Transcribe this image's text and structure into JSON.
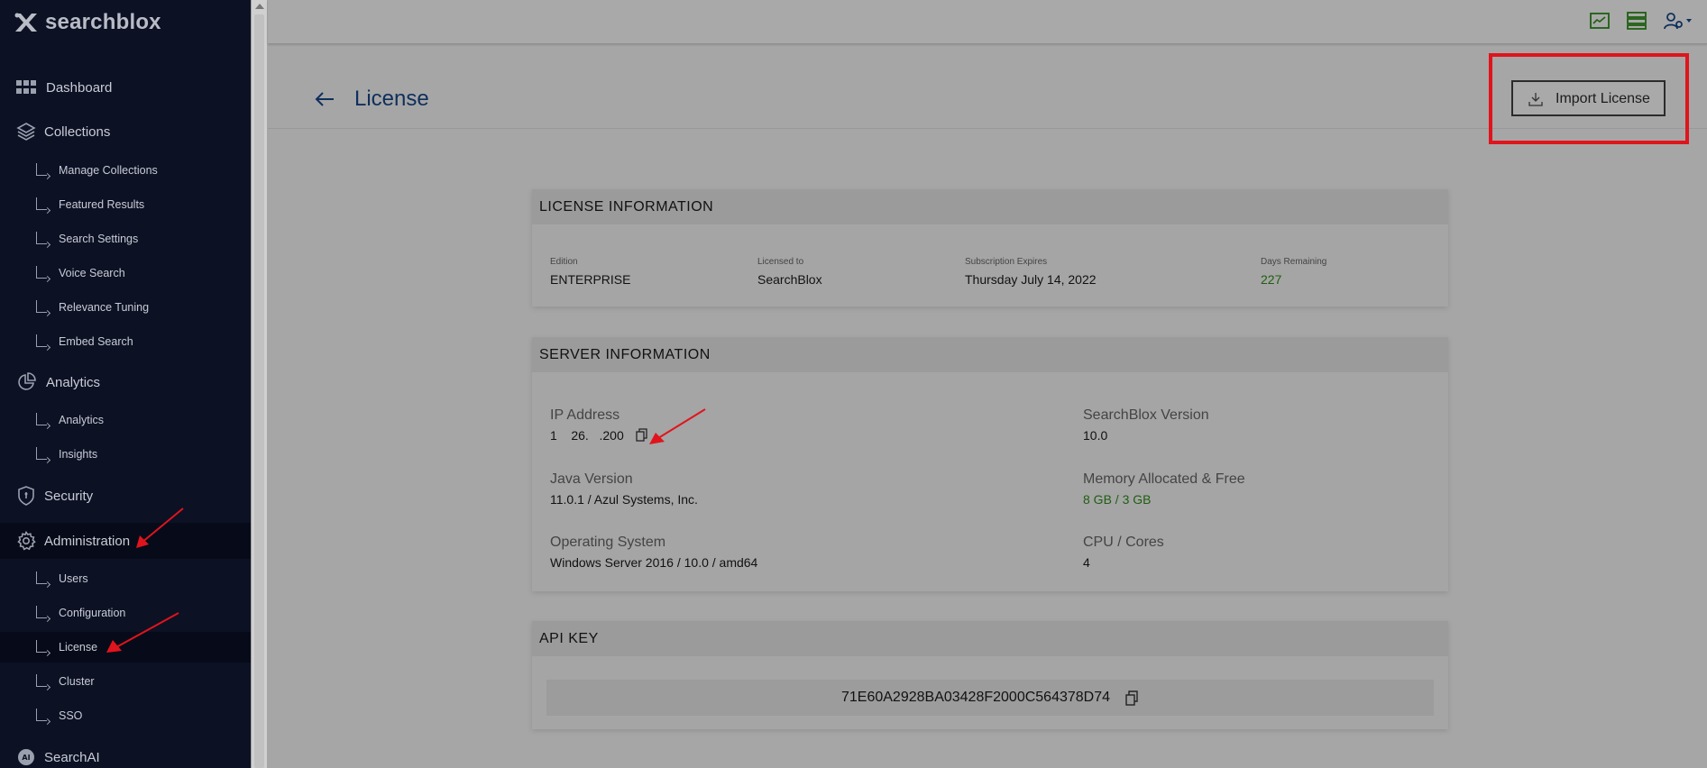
{
  "app": {
    "logo_text": "searchblox"
  },
  "sidebar": {
    "sections": [
      {
        "label": "Dashboard",
        "icon": "grid-icon"
      },
      {
        "label": "Collections",
        "icon": "layers-icon",
        "items": [
          "Manage Collections",
          "Featured Results",
          "Search Settings",
          "Voice Search",
          "Relevance Tuning",
          "Embed Search"
        ]
      },
      {
        "label": "Analytics",
        "icon": "pie-chart-icon",
        "items": [
          "Analytics",
          "Insights"
        ]
      },
      {
        "label": "Security",
        "icon": "shield-icon"
      },
      {
        "label": "Administration",
        "icon": "gear-icon",
        "items": [
          "Users",
          "Configuration",
          "License",
          "Cluster",
          "SSO"
        ]
      },
      {
        "label": "SearchAI",
        "icon": "ai-chip-icon"
      }
    ],
    "active_section": "Administration",
    "active_item": "License"
  },
  "header": {
    "title": "License",
    "import_button": "Import License"
  },
  "license_info": {
    "heading": "LICENSE INFORMATION",
    "edition_label": "Edition",
    "edition": "ENTERPRISE",
    "licensed_to_label": "Licensed to",
    "licensed_to": "SearchBlox",
    "expires_label": "Subscription Expires",
    "expires": "Thursday July 14, 2022",
    "days_label": "Days Remaining",
    "days": "227"
  },
  "server_info": {
    "heading": "SERVER INFORMATION",
    "ip_label": "IP Address",
    "ip": "1    26.   .200",
    "version_label": "SearchBlox Version",
    "version": "10.0",
    "java_label": "Java Version",
    "java": "11.0.1 / Azul Systems, Inc.",
    "memory_label": "Memory Allocated & Free",
    "memory": "8 GB / 3 GB",
    "os_label": "Operating System",
    "os": "Windows Server 2016 / 10.0 / amd64",
    "cpu_label": "CPU / Cores",
    "cpu": "4"
  },
  "api_key": {
    "heading": "API KEY",
    "value": "71E60A2928BA03428F2000C564378D74"
  },
  "colors": {
    "sidebar_bg": "#0c1124",
    "title": "#0f2f5c",
    "green": "#1f5e12",
    "highlight": "#e0141c"
  }
}
